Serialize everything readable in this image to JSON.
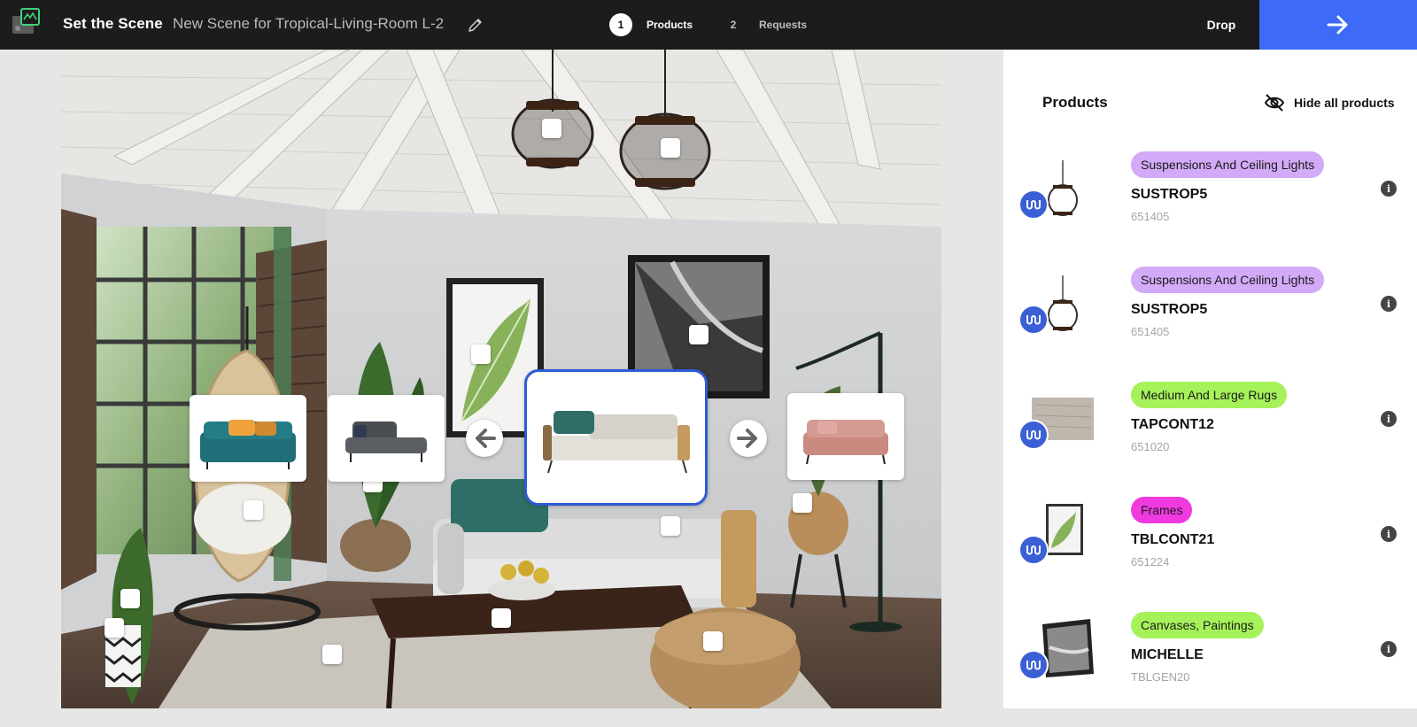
{
  "header": {
    "app_title": "Set the Scene",
    "scene_name": "New Scene for Tropical-Living-Room L-2",
    "steps": [
      {
        "number": "1",
        "label": "Products",
        "active": true
      },
      {
        "number": "2",
        "label": "Requests",
        "active": false
      }
    ],
    "drop_label": "Drop",
    "accent_color": "#3d6af7"
  },
  "panel": {
    "title": "Products",
    "hide_all_label": "Hide all products",
    "products": [
      {
        "category": "Suspensions And Ceiling Lights",
        "category_color": "#d2aaf7",
        "name": "SUSTROP5",
        "ref": "651405",
        "thumb": "pendant-lamp"
      },
      {
        "category": "Suspensions And Ceiling Lights",
        "category_color": "#d2aaf7",
        "name": "SUSTROP5",
        "ref": "651405",
        "thumb": "pendant-lamp"
      },
      {
        "category": "Medium And Large Rugs",
        "category_color": "#a6f25a",
        "name": "TAPCONT12",
        "ref": "651020",
        "thumb": "rug"
      },
      {
        "category": "Frames",
        "category_color": "#f03ae0",
        "name": "TBLCONT21",
        "ref": "651224",
        "thumb": "leaf-frame"
      },
      {
        "category": "Canvases, Paintings",
        "category_color": "#a6f25a",
        "name": "MICHELLE",
        "ref": "TBLGEN20",
        "thumb": "bw-canvas"
      }
    ]
  },
  "carousel": {
    "items": [
      "teal-sofa",
      "grey-chaise",
      "beige-sofa",
      "pink-sofa"
    ],
    "selected": "beige-sofa"
  }
}
